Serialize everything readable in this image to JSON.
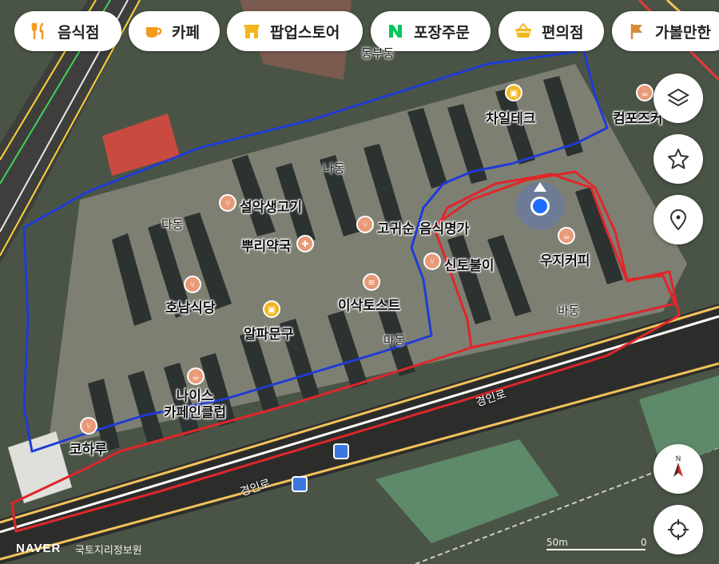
{
  "categories": [
    {
      "label": "음식점",
      "icon": "fork-knife-icon",
      "color": "#f29a1d"
    },
    {
      "label": "카페",
      "icon": "coffee-cup-icon",
      "color": "#f29a1d"
    },
    {
      "label": "팝업스토어",
      "icon": "store-icon",
      "color": "#f2b71d"
    },
    {
      "label": "포장주문",
      "icon": "naver-n-icon",
      "color": "#03c75a"
    },
    {
      "label": "편의점",
      "icon": "basket-icon",
      "color": "#f2b71d"
    },
    {
      "label": "가볼만한",
      "icon": "flag-icon",
      "color": "#d68a3a"
    }
  ],
  "places": {
    "chailtech": "차일테크",
    "compose": "컴포즈커",
    "seolak": "설악생고기",
    "gogwisun": "고귀순 음식명가",
    "ppuri": "뿌리약국",
    "sintobul": "신토불이",
    "uji": "우지커피",
    "honam": "호남식당",
    "isak": "이삭토스트",
    "alpa": "알파문구",
    "nice": "나이스\n카페인클럽",
    "kohalu": "코하루"
  },
  "dongs": {
    "na": "나동",
    "da": "다동",
    "ma": "마동",
    "ba": "바동",
    "dong_top": "동부동"
  },
  "roads": {
    "gyeongin1": "경인로",
    "gyeongin2": "경인로"
  },
  "footer": {
    "brand": "NAVER",
    "source": "국토지리정보원",
    "scale": "50m",
    "scale_zero": "0"
  },
  "controls": [
    "layers-icon",
    "star-icon",
    "location-pin-icon",
    "compass-icon",
    "current-location-icon"
  ]
}
